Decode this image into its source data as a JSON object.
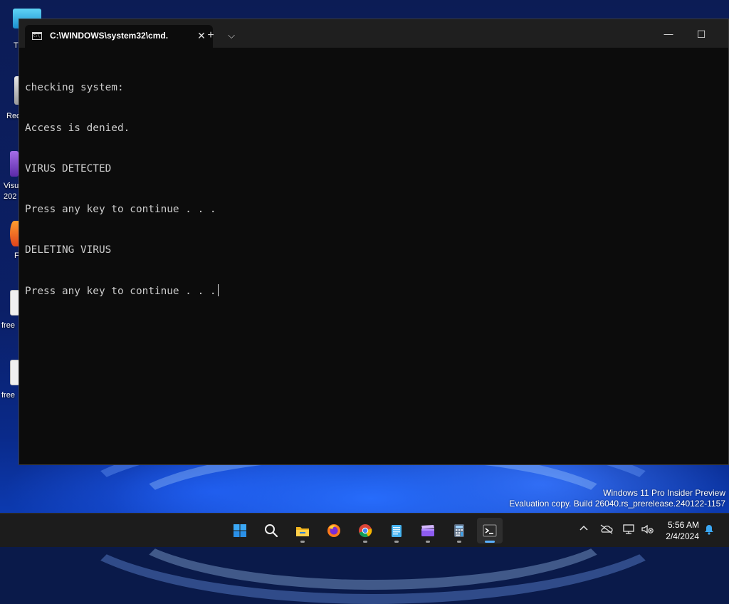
{
  "desktop": {
    "icons": [
      {
        "label": "T"
      },
      {
        "label": "Rec"
      },
      {
        "label": "Visu"
      },
      {
        "label": "202"
      },
      {
        "label": "F"
      },
      {
        "label": "free"
      },
      {
        "label": "free"
      }
    ],
    "watermark": {
      "line1": "Windows 11 Pro Insider Preview",
      "line2": "Evaluation copy. Build 26040.rs_prerelease.240122-1157"
    }
  },
  "window": {
    "tab_title": "C:\\WINDOWS\\system32\\cmd.",
    "new_tab_symbol": "+",
    "dropdown_symbol": "⌵",
    "close_symbol": "✕",
    "minimize_symbol": "—",
    "maximize_symbol": "☐"
  },
  "console": {
    "lines": [
      "checking system:",
      "Access is denied.",
      "VIRUS DETECTED",
      "Press any key to continue . . .",
      "DELETING VIRUS",
      "Press any key to continue . . ."
    ]
  },
  "taskbar": {
    "apps": [
      {
        "name": "start",
        "icon": "windows-logo-icon"
      },
      {
        "name": "search",
        "icon": "search-icon"
      },
      {
        "name": "file-explorer",
        "icon": "folder-icon"
      },
      {
        "name": "firefox",
        "icon": "firefox-icon"
      },
      {
        "name": "chrome",
        "icon": "chrome-icon"
      },
      {
        "name": "notepad",
        "icon": "notepad-icon"
      },
      {
        "name": "clipchamp",
        "icon": "clapper-icon"
      },
      {
        "name": "calculator",
        "icon": "calculator-icon"
      },
      {
        "name": "terminal",
        "icon": "terminal-icon"
      }
    ],
    "clock": {
      "time": "5:56 AM",
      "date": "2/4/2024"
    },
    "tray_chevron": "^"
  },
  "colors": {
    "console_bg": "#0c0c0c",
    "console_text": "#cccccc",
    "taskbar_bg": "#1c1c1c",
    "accent": "#5ab0ff"
  }
}
